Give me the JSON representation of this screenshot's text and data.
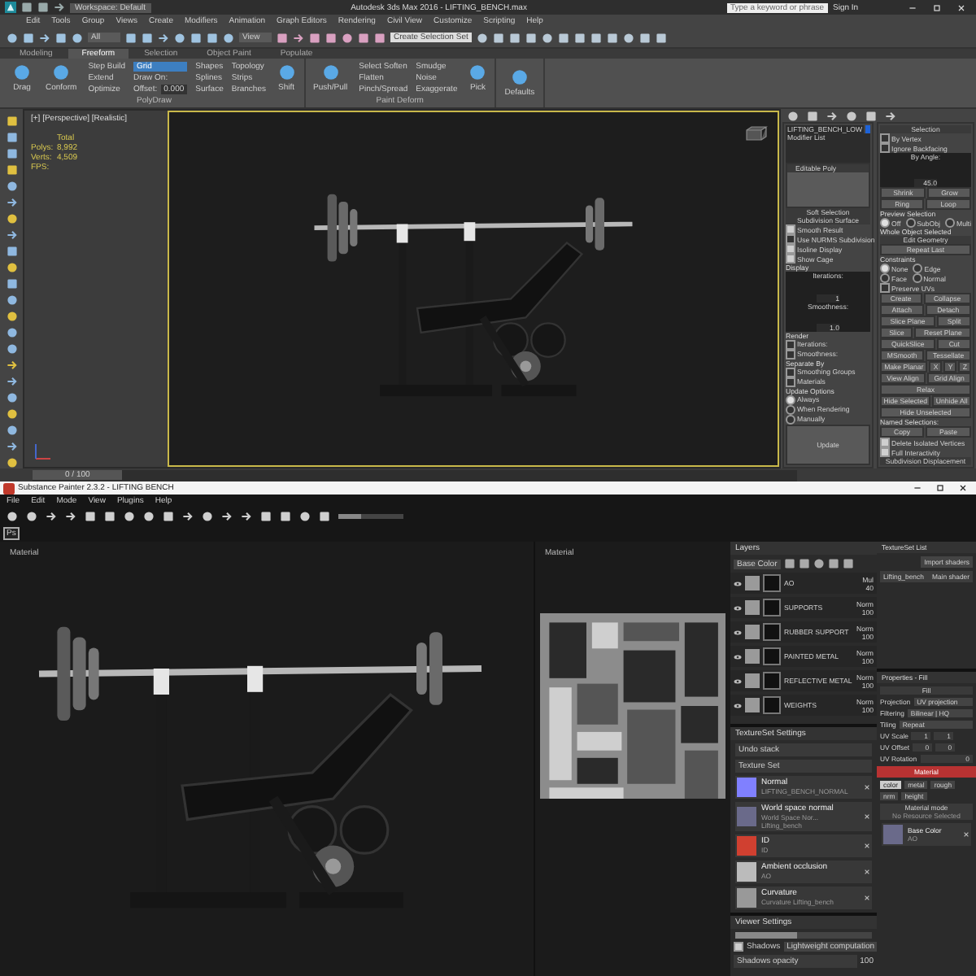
{
  "max": {
    "title": "Autodesk 3ds Max 2016 - LIFTING_BENCH.max",
    "workspace": "Workspace: Default",
    "search_placeholder": "Type a keyword or phrase",
    "sign_in": "Sign In",
    "menu": [
      "Edit",
      "Tools",
      "Group",
      "Views",
      "Create",
      "Modifiers",
      "Animation",
      "Graph Editors",
      "Rendering",
      "Civil View",
      "Customize",
      "Scripting",
      "Help"
    ],
    "toolbar": {
      "selection_filter": "All",
      "reference_coord": "View",
      "named_selection_placeholder": "Create Selection Set"
    },
    "ribbon_tabs": [
      {
        "label": "Modeling",
        "selected": false
      },
      {
        "label": "Freeform",
        "selected": true
      },
      {
        "label": "Selection",
        "selected": false
      },
      {
        "label": "Object Paint",
        "selected": false
      },
      {
        "label": "Populate",
        "selected": false
      }
    ],
    "ribbon_groups": [
      {
        "title": "PolyDraw",
        "items": [
          {
            "kind": "large",
            "labels": [
              "Drag"
            ]
          },
          {
            "kind": "large",
            "labels": [
              "Conform"
            ]
          },
          {
            "kind": "stack",
            "labels": [
              "Step Build",
              "Extend",
              "Optimize"
            ]
          },
          {
            "kind": "drawon",
            "labels": [
              "Grid",
              "Draw On:",
              "Offset:",
              "0.000"
            ]
          },
          {
            "kind": "stack",
            "labels": [
              "Shapes",
              "Splines",
              "Surface"
            ]
          },
          {
            "kind": "stack",
            "labels": [
              "Topology",
              "Strips",
              "Branches"
            ]
          },
          {
            "kind": "large",
            "labels": [
              "Shift"
            ]
          }
        ]
      },
      {
        "title": "Paint Deform",
        "items": [
          {
            "kind": "large",
            "labels": [
              "Push/Pull"
            ]
          },
          {
            "kind": "stack",
            "labels": [
              "Select Soften",
              "Flatten",
              "Pinch/Spread"
            ]
          },
          {
            "kind": "stack",
            "labels": [
              "Smudge",
              "Noise",
              "Exaggerate"
            ]
          },
          {
            "kind": "large",
            "labels": [
              "Pick"
            ]
          }
        ]
      },
      {
        "items": [
          {
            "kind": "large",
            "labels": [
              "Defaults"
            ]
          }
        ]
      }
    ],
    "viewport": {
      "label": "[+] [Perspective] [Realistic]",
      "stats": [
        {
          "value": "Total"
        },
        {
          "label": "Polys:",
          "value": "8,992"
        },
        {
          "label": "Verts:",
          "value": "4,509"
        },
        {
          "label": "FPS:"
        }
      ]
    },
    "command_left": [
      {
        "kind": "field",
        "text": "LIFTING_BENCH_LOW"
      },
      {
        "kind": "dropdown",
        "text": "Modifier List"
      },
      {
        "kind": "stack",
        "text": "Editable Poly"
      },
      {
        "kind": "rollout",
        "text": "Soft Selection"
      },
      {
        "kind": "heading",
        "text": "Subdivision Surface"
      },
      {
        "kind": "check",
        "text": "Smooth Result",
        "checked": true
      },
      {
        "kind": "check",
        "text": "Use NURMS Subdivision",
        "checked": false
      },
      {
        "kind": "check",
        "text": "Isoline Display",
        "checked": true
      },
      {
        "kind": "check",
        "text": "Show Cage",
        "checked": true
      },
      {
        "kind": "label",
        "text": "Display"
      },
      {
        "kind": "spinner",
        "text": "Iterations:",
        "value": "1"
      },
      {
        "kind": "spinner",
        "text": "Smoothness:",
        "value": "1.0"
      },
      {
        "kind": "label",
        "text": "Render"
      },
      {
        "kind": "check",
        "text": "Iterations:",
        "checked": false
      },
      {
        "kind": "check",
        "text": "Smoothness:",
        "checked": false
      },
      {
        "kind": "label",
        "text": "Separate By"
      },
      {
        "kind": "check",
        "text": "Smoothing Groups",
        "checked": false
      },
      {
        "kind": "check",
        "text": "Materials",
        "checked": false
      },
      {
        "kind": "label",
        "text": "Update Options"
      },
      {
        "kind": "radio",
        "text": "Always",
        "selected": true
      },
      {
        "kind": "radio",
        "text": "When Rendering",
        "selected": false
      },
      {
        "kind": "radio",
        "text": "Manually",
        "selected": false
      },
      {
        "kind": "button",
        "text": "Update"
      }
    ],
    "command_right": [
      {
        "kind": "heading",
        "text": "Selection"
      },
      {
        "kind": "check",
        "text": "By Vertex",
        "checked": false
      },
      {
        "kind": "check",
        "text": "Ignore Backfacing",
        "checked": false
      },
      {
        "kind": "spinner",
        "text": "By Angle:",
        "value": "45.0"
      },
      {
        "kind": "buttons",
        "items": [
          "Shrink",
          "Grow"
        ]
      },
      {
        "kind": "buttons",
        "items": [
          "Ring",
          "Loop"
        ]
      },
      {
        "kind": "label",
        "text": "Preview Selection"
      },
      {
        "kind": "radios",
        "options": [
          {
            "label": "Off",
            "selected": true
          },
          {
            "label": "SubObj",
            "selected": false
          },
          {
            "label": "Multi",
            "selected": false
          }
        ]
      },
      {
        "kind": "label",
        "text": "Whole Object Selected"
      },
      {
        "kind": "heading",
        "text": "Edit Geometry"
      },
      {
        "kind": "buttons",
        "items": [
          "Repeat Last"
        ]
      },
      {
        "kind": "label",
        "text": "Constraints"
      },
      {
        "kind": "radios",
        "options": [
          {
            "label": "None",
            "selected": true
          },
          {
            "label": "Edge",
            "selected": false
          }
        ]
      },
      {
        "kind": "radios",
        "options": [
          {
            "label": "Face",
            "selected": false
          },
          {
            "label": "Normal",
            "selected": false
          }
        ]
      },
      {
        "kind": "check",
        "text": "Preserve UVs",
        "checked": false
      },
      {
        "kind": "buttons",
        "items": [
          "Create",
          "Collapse"
        ]
      },
      {
        "kind": "buttons",
        "items": [
          "Attach",
          "Detach"
        ]
      },
      {
        "kind": "buttons",
        "items": [
          "Slice Plane",
          "Split"
        ]
      },
      {
        "kind": "buttons",
        "items": [
          "Slice",
          "Reset Plane"
        ]
      },
      {
        "kind": "buttons",
        "items": [
          "QuickSlice",
          "Cut"
        ]
      },
      {
        "kind": "buttons",
        "items": [
          "MSmooth",
          "Tessellate"
        ]
      },
      {
        "kind": "buttons",
        "items": [
          "Make Planar",
          "X",
          "Y",
          "Z"
        ]
      },
      {
        "kind": "buttons",
        "items": [
          "View Align",
          "Grid Align"
        ]
      },
      {
        "kind": "buttons",
        "items": [
          "Relax"
        ]
      },
      {
        "kind": "buttons",
        "items": [
          "Hide Selected",
          "Unhide All"
        ]
      },
      {
        "kind": "buttons",
        "items": [
          "Hide Unselected"
        ]
      },
      {
        "kind": "label",
        "text": "Named Selections:"
      },
      {
        "kind": "buttons",
        "items": [
          "Copy",
          "Paste"
        ]
      },
      {
        "kind": "check",
        "text": "Delete Isolated Vertices",
        "checked": true
      },
      {
        "kind": "check",
        "text": "Full Interactivity",
        "checked": true
      },
      {
        "kind": "rollout",
        "text": "Subdivision Displacement"
      }
    ],
    "timeline": {
      "text": "0 / 100",
      "level": 0
    }
  },
  "painter": {
    "title": "Substance Painter 2.3.2 - LIFTING BENCH",
    "menu": [
      "File",
      "Edit",
      "Mode",
      "View",
      "Plugins",
      "Help"
    ],
    "ps_button": "Ps",
    "brush_size": {
      "level": 0.35
    },
    "viewports": [
      "Material",
      "Material"
    ],
    "layers": {
      "title": "Layers",
      "channel": "Base Color",
      "items": [
        {
          "name": "AO",
          "blend": "Mul",
          "opacity": "40"
        },
        {
          "name": "SUPPORTS",
          "blend": "Norm",
          "opacity": "100"
        },
        {
          "name": "RUBBER SUPPORT",
          "blend": "Norm",
          "opacity": "100"
        },
        {
          "name": "PAINTED METAL",
          "blend": "Norm",
          "opacity": "100"
        },
        {
          "name": "REFLECTIVE METAL",
          "blend": "Norm",
          "opacity": "100"
        },
        {
          "name": "WEIGHTS",
          "blend": "Norm",
          "opacity": "100"
        }
      ]
    },
    "texture_set_list": {
      "title": "TextureSet List",
      "button": "Import shaders",
      "items": [
        {
          "name": "Lifting_bench",
          "shader": "Main shader"
        }
      ]
    },
    "texture_set_settings": {
      "title": "TextureSet Settings",
      "fields": [
        "Undo stack",
        "Texture Set"
      ],
      "maps": [
        {
          "kind": "normal",
          "title": "Normal",
          "subtitle": "LIFTING_BENCH_NORMAL"
        },
        {
          "kind": "world",
          "title": "World space normal",
          "subtitle": "World Space Nor... Lifting_bench"
        },
        {
          "kind": "id",
          "title": "ID",
          "subtitle": "ID"
        },
        {
          "kind": "ao",
          "title": "Ambient occlusion",
          "subtitle": "AO"
        },
        {
          "kind": "curvature",
          "title": "Curvature",
          "subtitle": "Curvature Lifting_bench"
        }
      ]
    },
    "properties": {
      "title": "Properties - Fill",
      "section": "Fill",
      "rows": [
        {
          "kind": "select",
          "label": "Projection",
          "value": "UV projection"
        },
        {
          "kind": "select",
          "label": "Filtering",
          "value": "Bilinear | HQ"
        },
        {
          "kind": "select",
          "label": "Tiling",
          "value": "Repeat"
        },
        {
          "kind": "pair",
          "label": "UV Scale",
          "values": [
            "1",
            "1"
          ]
        },
        {
          "kind": "pair",
          "label": "UV Offset",
          "values": [
            "0",
            "0"
          ]
        },
        {
          "kind": "field",
          "label": "UV Rotation",
          "value": "0"
        }
      ],
      "material_title": "Material",
      "channels": [
        {
          "label": "color",
          "selected": true
        },
        {
          "label": "metal",
          "selected": false
        },
        {
          "label": "rough",
          "selected": false
        },
        {
          "label": "nrm",
          "selected": false
        },
        {
          "label": "height",
          "selected": false
        }
      ],
      "material_mode": "Material mode",
      "material_mode_value": "No Resource Selected",
      "base_color": "Base Color",
      "base_color_value": "AO"
    },
    "viewer": {
      "title": "Viewer Settings",
      "level": 0.45,
      "shadows": {
        "label": "Shadows",
        "checked": true
      },
      "computation": "Lightweight computation",
      "opacity_label": "Shadows opacity",
      "opacity_value": "100"
    }
  }
}
